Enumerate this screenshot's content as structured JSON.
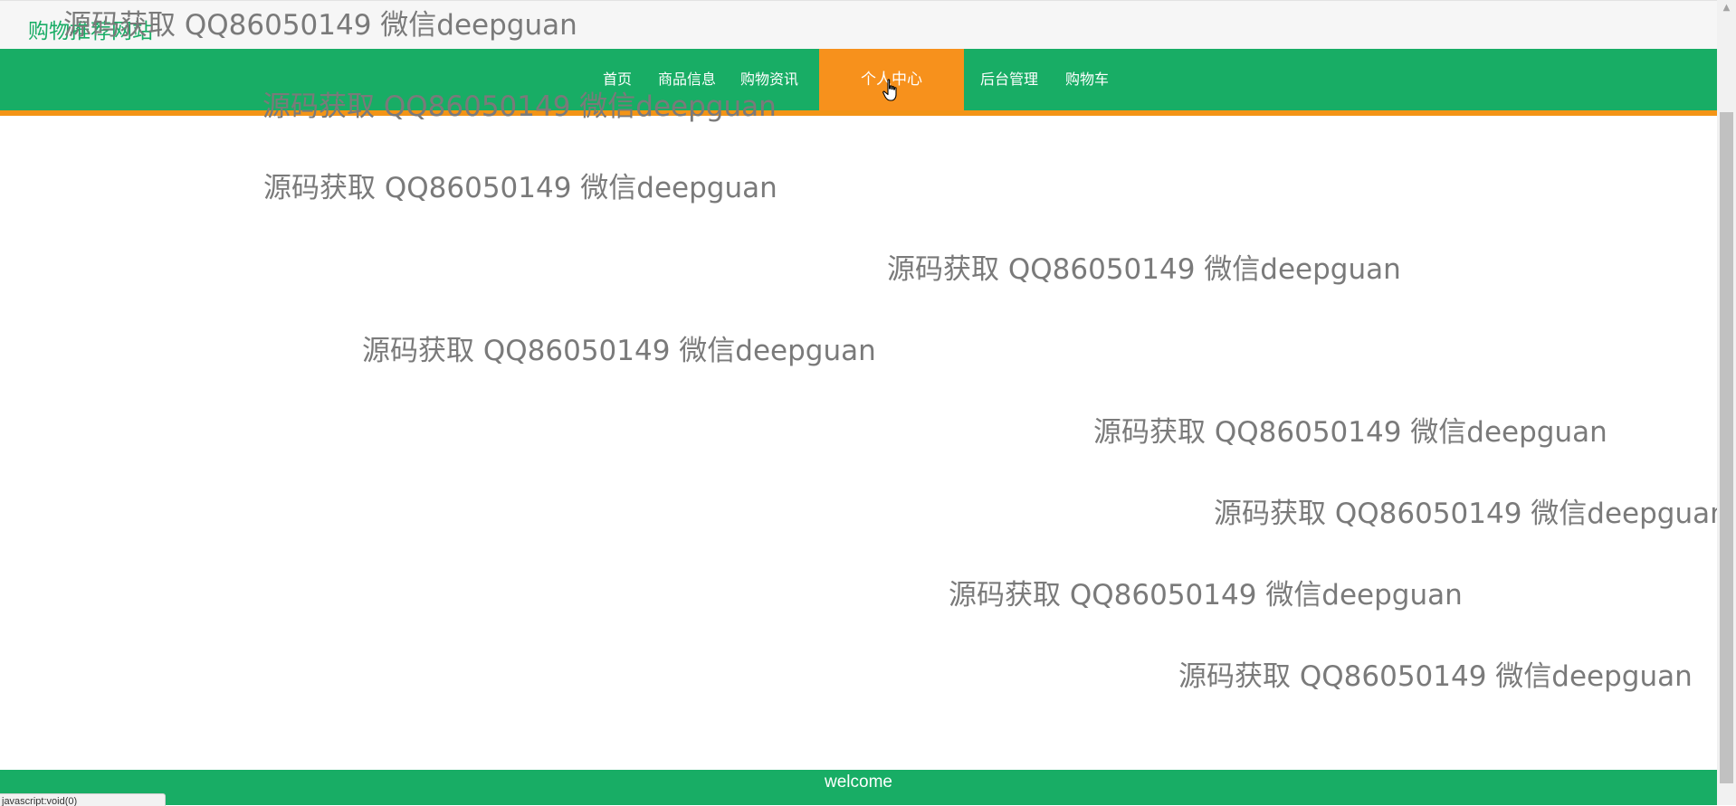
{
  "site": {
    "title": "购物推荐网站"
  },
  "nav": {
    "items": [
      {
        "label": "首页"
      },
      {
        "label": "商品信息"
      },
      {
        "label": "购物资讯"
      },
      {
        "label": "个人中心",
        "active": true
      },
      {
        "label": "后台管理"
      },
      {
        "label": "购物车"
      }
    ]
  },
  "watermark_text": "源码获取 QQ86050149 微信deepguan",
  "footer": {
    "text": "welcome"
  },
  "status": {
    "text": "javascript:void(0)"
  },
  "colors": {
    "primary": "#18ad65",
    "accent": "#f7911c",
    "title": "#1aad66"
  }
}
